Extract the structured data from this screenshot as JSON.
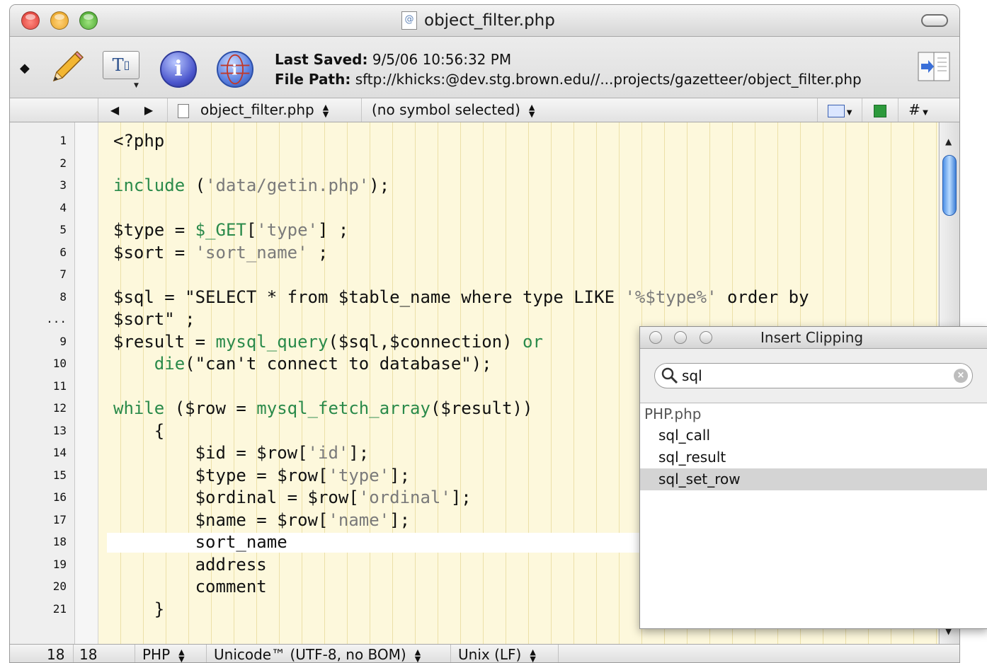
{
  "window": {
    "title": "object_filter.php",
    "title_icon_glyph": "@"
  },
  "toolbar": {
    "last_saved_label": "Last Saved:",
    "last_saved_value": "9/5/06 10:56:32 PM",
    "file_path_label": "File Path:",
    "file_path_value": "sftp://khicks:@dev.stg.brown.edu//...projects/gazetteer/object_filter.php",
    "text_button_label": "T"
  },
  "navbar": {
    "back_glyph": "◀",
    "forward_glyph": "▶",
    "file": "object_filter.php",
    "symbol": "(no symbol selected)",
    "hash_glyph": "#"
  },
  "editor": {
    "lines": [
      {
        "num": "1",
        "text": "<?php"
      },
      {
        "num": "2",
        "text": ""
      },
      {
        "num": "3",
        "text": "include ('data/getin.php');"
      },
      {
        "num": "4",
        "text": ""
      },
      {
        "num": "5",
        "text": "$type = $_GET['type'] ;"
      },
      {
        "num": "6",
        "text": "$sort = 'sort_name' ;"
      },
      {
        "num": "7",
        "text": ""
      },
      {
        "num": "8",
        "text": "$sql = \"SELECT * from $table_name where type LIKE '%$type%' order by"
      },
      {
        "num": "...",
        "text": "$sort\" ;"
      },
      {
        "num": "9",
        "text": "$result = mysql_query($sql,$connection) or"
      },
      {
        "num": "10",
        "text": "    die(\"can't connect to database\");"
      },
      {
        "num": "11",
        "text": ""
      },
      {
        "num": "12",
        "text": "while ($row = mysql_fetch_array($result))"
      },
      {
        "num": "13",
        "text": "    {"
      },
      {
        "num": "14",
        "text": "        $id = $row['id'];"
      },
      {
        "num": "15",
        "text": "        $type = $row['type'];"
      },
      {
        "num": "16",
        "text": "        $ordinal = $row['ordinal'];"
      },
      {
        "num": "17",
        "text": "        $name = $row['name'];"
      },
      {
        "num": "18",
        "text": "        sort_name"
      },
      {
        "num": "19",
        "text": "        address"
      },
      {
        "num": "20",
        "text": "        comment"
      },
      {
        "num": "21",
        "text": "    }"
      }
    ]
  },
  "statusbar": {
    "line": "18",
    "column": "18",
    "language": "PHP",
    "encoding": "Unicode™ (UTF-8, no BOM)",
    "line_endings": "Unix (LF)"
  },
  "clipping": {
    "title": "Insert Clipping",
    "search_value": "sql",
    "group": "PHP.php",
    "items": [
      "sql_call",
      "sql_result",
      "sql_set_row"
    ],
    "selected_index": 2
  },
  "colors": {
    "editor_background": "#fdf8dc",
    "keyword": "#2a8a4a",
    "string": "#7a7a7a",
    "close": "#e0443e",
    "minimize": "#f3b02a",
    "zoom": "#5cbf36"
  }
}
